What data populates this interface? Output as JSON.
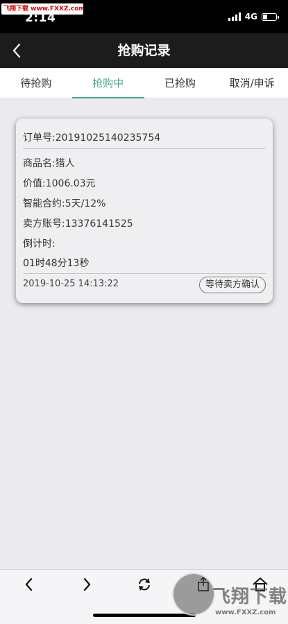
{
  "status_bar": {
    "watermark": "飞翔下载 www.FXXZ.com",
    "time": "2:14",
    "network": "4G",
    "battery_level": 0.35
  },
  "nav": {
    "back_icon": "chevron-left-icon",
    "title": "抢购记录"
  },
  "tabs": [
    {
      "label": "待抢购",
      "active": false
    },
    {
      "label": "抢购中",
      "active": true
    },
    {
      "label": "已抢购",
      "active": false
    },
    {
      "label": "取消/申诉",
      "active": false
    }
  ],
  "accent_color": "#45a98f",
  "order": {
    "order_no": "订单号:20191025140235754",
    "product_name": "商品名:猎人",
    "value": "价值:1006.03元",
    "contract": "智能合约:5天/12%",
    "seller_account": "卖方账号:13376141525",
    "countdown_label": "倒计时:",
    "countdown": "01时48分13秒",
    "timestamp": "2019-10-25 14:13:22",
    "status": "等待卖方确认"
  },
  "toolbar": {
    "icons": [
      "back-icon",
      "forward-icon",
      "refresh-icon",
      "share-icon",
      "home-icon"
    ]
  },
  "watermark_logo": {
    "text": "飞翔下载",
    "url": "www.FXXZ.com"
  }
}
